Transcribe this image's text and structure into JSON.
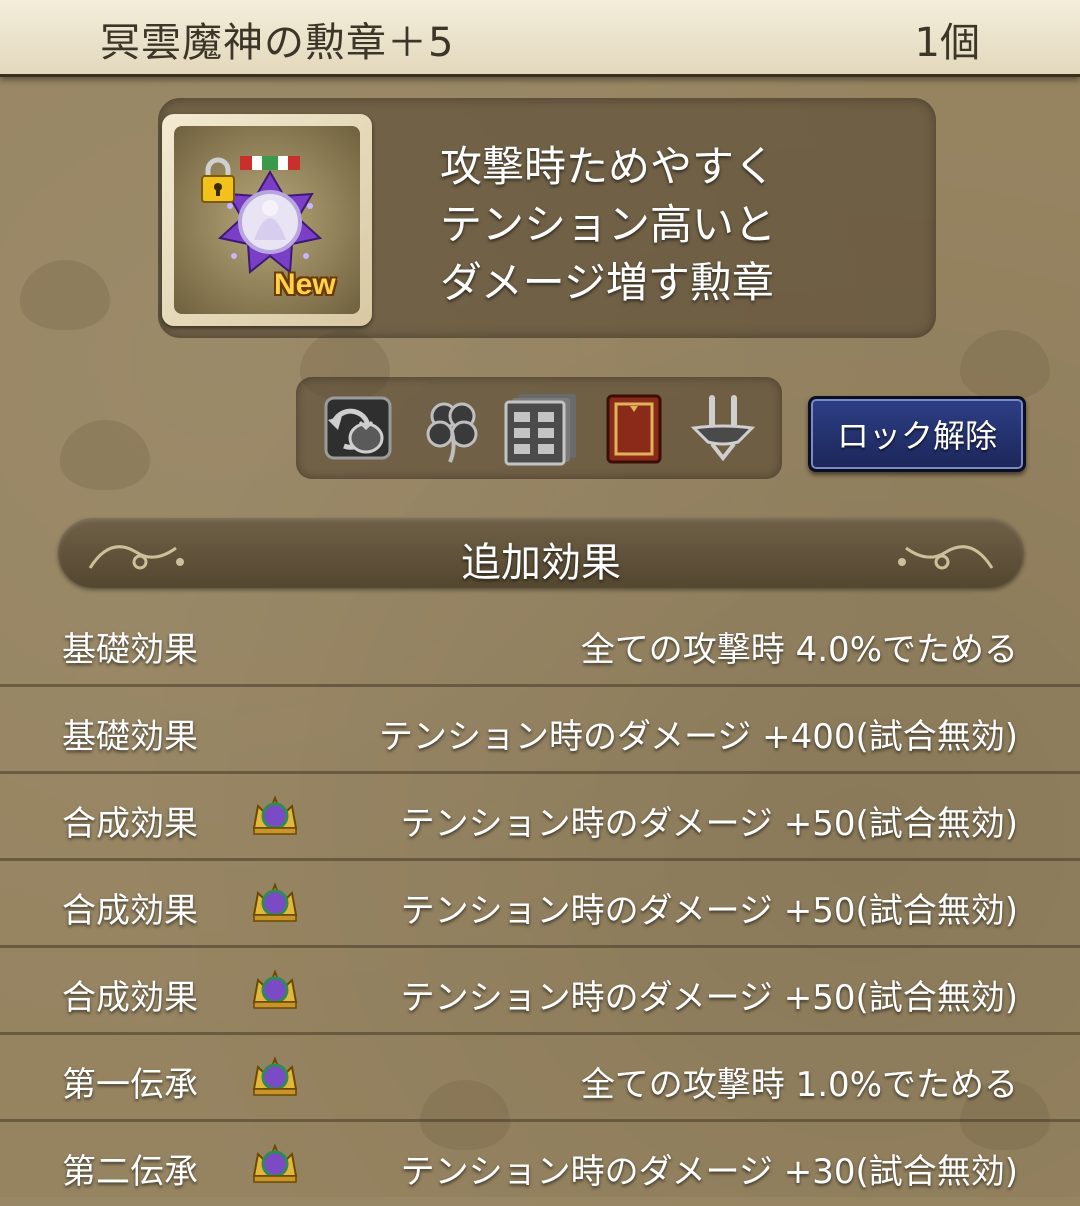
{
  "header": {
    "title": "冥雲魔神の勲章＋5",
    "count": "1個"
  },
  "item": {
    "new_badge": "New",
    "description": [
      "攻撃時ためやすく",
      "テンション高いと",
      "ダメージ増す勲章"
    ]
  },
  "actions": {
    "icons": [
      "sell-bag-icon",
      "clover-icon",
      "storage-drawer-icon",
      "book-icon",
      "transfer-icon"
    ],
    "unlock_label": "ロック解除"
  },
  "section": {
    "title": "追加効果"
  },
  "effects": [
    {
      "label": "基礎効果",
      "value": "全ての攻撃時  4.0%でためる",
      "crown": false
    },
    {
      "label": "基礎効果",
      "value": "テンション時のダメージ  +400(試合無効)",
      "crown": false
    },
    {
      "label": "合成効果",
      "value": "テンション時のダメージ  +50(試合無効)",
      "crown": true
    },
    {
      "label": "合成効果",
      "value": "テンション時のダメージ  +50(試合無効)",
      "crown": true
    },
    {
      "label": "合成効果",
      "value": "テンション時のダメージ  +50(試合無効)",
      "crown": true
    },
    {
      "label": "第一伝承",
      "value": "全ての攻撃時  1.0%でためる",
      "crown": true
    },
    {
      "label": "第二伝承",
      "value": "テンション時のダメージ  +30(試合無効)",
      "crown": true
    }
  ],
  "colors": {
    "background": "#968461",
    "header_bg": "#efe8d2",
    "button_blue": "#26337a",
    "new_badge": "#ffd24a"
  }
}
